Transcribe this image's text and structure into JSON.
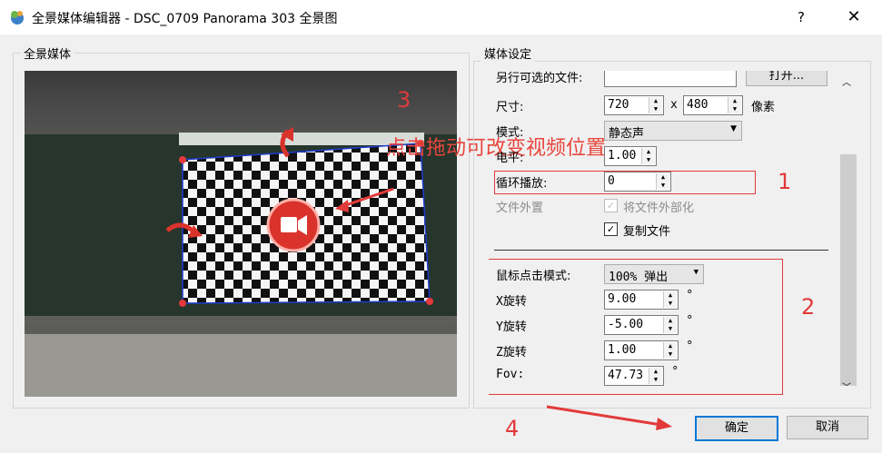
{
  "window": {
    "title": "全景媒体编辑器 - DSC_0709 Panorama 303 全景图",
    "help": "?",
    "close": "✕"
  },
  "left_group": {
    "title": "全景媒体"
  },
  "right_group": {
    "title": "媒体设定"
  },
  "settings": {
    "alt_file_label": "另行可选的文件:",
    "alt_file_value": "",
    "open_button": "打开...",
    "size_label": "尺寸:",
    "width": "720",
    "x_sep": "x",
    "height": "480",
    "size_unit": "像素",
    "mode_label": "模式:",
    "mode_value": "静态声",
    "level_label": "电平:",
    "level_value": "1.00",
    "loop_label": "循环播放:",
    "loop_value": "0",
    "external_label": "文件外置",
    "externalize_label": "将文件外部化",
    "externalize_checked": true,
    "copy_label": "复制文件",
    "copy_checked": true,
    "click_mode_label": "鼠标点击模式:",
    "click_mode_value": "100% 弹出",
    "xrot_label": "X旋转",
    "xrot_value": "9.00",
    "yrot_label": "Y旋转",
    "yrot_value": "-5.00",
    "zrot_label": "Z旋转",
    "zrot_value": "1.00",
    "fov_label": "Fov:",
    "fov_value": "47.73",
    "degree": "°"
  },
  "footer": {
    "ok": "确定",
    "cancel": "取消"
  },
  "annotations": {
    "n1": "1",
    "n2": "2",
    "n3": "3",
    "n4": "4",
    "drag_hint": "点击拖动可改变视频位置",
    "color": "#e23a3a"
  }
}
